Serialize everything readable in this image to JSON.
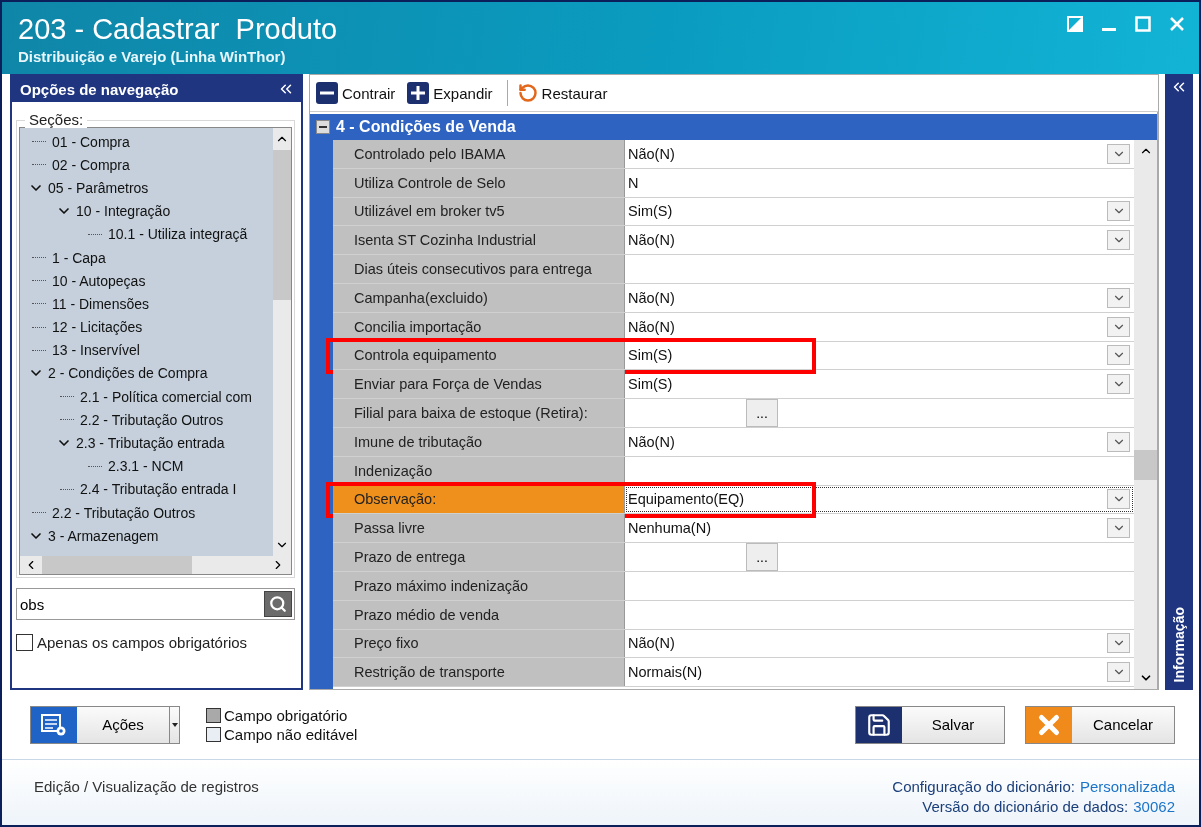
{
  "window": {
    "title": "203 - Cadastrar  Produto",
    "subtitle": "Distribuição e Varejo (Linha WinThor)"
  },
  "navigation": {
    "title": "Opções de navegação",
    "sections_label": "Seções:",
    "tree": [
      {
        "label": "01 - Compra"
      },
      {
        "label": "02 - Compra"
      },
      {
        "label": "05 - Parâmetros",
        "expanded": true,
        "children": [
          {
            "label": "10 - Integração",
            "expanded": true,
            "children": [
              {
                "label": "10.1 - Utiliza integraçã"
              }
            ]
          }
        ]
      },
      {
        "label": "1 - Capa"
      },
      {
        "label": "10 - Autopeças"
      },
      {
        "label": "11 - Dimensões"
      },
      {
        "label": "12 - Licitações"
      },
      {
        "label": "13 - Inservível"
      },
      {
        "label": "2 - Condições de Compra",
        "expanded": true,
        "children": [
          {
            "label": "2.1 - Política comercial com"
          },
          {
            "label": "2.2 - Tributação Outros"
          },
          {
            "label": "2.3 - Tributação entrada",
            "expanded": true,
            "children": [
              {
                "label": "2.3.1 - NCM"
              }
            ]
          },
          {
            "label": "2.4 - Tributação entrada I"
          }
        ]
      },
      {
        "label": "2.2 - Tributação Outros"
      },
      {
        "label": "3 - Armazenagem",
        "expanded": true
      }
    ],
    "search": {
      "value": "obs"
    },
    "required_only": {
      "label": "Apenas os campos obrigatórios",
      "checked": false
    }
  },
  "toolbar": [
    {
      "label": "Contrair",
      "kind": "collapse"
    },
    {
      "label": "Expandir",
      "kind": "expand"
    },
    {
      "label": "Restaurar",
      "kind": "restore"
    }
  ],
  "section": {
    "title": "4 - Condições de Venda",
    "expanded": true,
    "rows": [
      {
        "label": "Controlado pelo IBAMA",
        "value": "Não(N)",
        "kind": "dropdown",
        "selected": false,
        "annotated": false
      },
      {
        "label": "Utiliza Controle de Selo",
        "value": "N",
        "kind": "text",
        "selected": false,
        "annotated": false
      },
      {
        "label": "Utilizável em broker tv5",
        "value": "Sim(S)",
        "kind": "dropdown",
        "selected": false,
        "annotated": false
      },
      {
        "label": "Isenta ST Cozinha Industrial",
        "value": "Não(N)",
        "kind": "dropdown",
        "selected": false,
        "annotated": false
      },
      {
        "label": "Dias úteis consecutivos para entrega",
        "kind": "text",
        "selected": false,
        "annotated": false
      },
      {
        "label": "Campanha(excluido)",
        "value": "Não(N)",
        "kind": "dropdown",
        "selected": false,
        "annotated": false
      },
      {
        "label": "Concilia importação",
        "value": "Não(N)",
        "kind": "dropdown",
        "selected": false,
        "annotated": false
      },
      {
        "label": "Controla equipamento",
        "value": "Sim(S)",
        "kind": "dropdown",
        "selected": false,
        "annotated": true
      },
      {
        "label": "Enviar para Força de Vendas",
        "value": "Sim(S)",
        "kind": "dropdown",
        "selected": false,
        "annotated": false
      },
      {
        "label": "Filial para baixa de estoque (Retira):",
        "kind": "lookup",
        "button": "...",
        "selected": false,
        "annotated": false
      },
      {
        "label": "Imune de tributação",
        "value": "Não(N)",
        "kind": "dropdown",
        "selected": false,
        "annotated": false
      },
      {
        "label": "Indenização",
        "kind": "text",
        "selected": false,
        "annotated": false
      },
      {
        "label": "Observação:",
        "value": "Equipamento(EQ)",
        "kind": "dropdown",
        "selected": true,
        "annotated": true
      },
      {
        "label": "Passa livre",
        "value": "Nenhuma(N)",
        "kind": "dropdown",
        "selected": false,
        "annotated": false
      },
      {
        "label": "Prazo de entrega",
        "kind": "lookup",
        "button": "...",
        "selected": false,
        "annotated": false
      },
      {
        "label": "Prazo máximo indenização",
        "kind": "text",
        "selected": false,
        "annotated": false
      },
      {
        "label": "Prazo médio de venda",
        "kind": "text",
        "selected": false,
        "annotated": false
      },
      {
        "label": "Preço fixo",
        "value": "Não(N)",
        "kind": "dropdown",
        "selected": false,
        "annotated": false
      },
      {
        "label": "Restrição de transporte",
        "value": "Normais(N)",
        "kind": "dropdown",
        "selected": false,
        "annotated": false
      }
    ]
  },
  "info_panel": {
    "label": "Informação"
  },
  "actions": {
    "label": "Ações"
  },
  "legend": [
    {
      "label": "Campo obrigatório",
      "color": "#a9a9a9"
    },
    {
      "label": "Campo não editável",
      "color": "#e8eef4"
    }
  ],
  "buttons": [
    {
      "label": "Salvar",
      "kind": "save"
    },
    {
      "label": "Cancelar",
      "kind": "cancel"
    }
  ],
  "status_bar": {
    "text": "Edição / Visualização de registros",
    "details": [
      {
        "label": "Configuração do dicionário:",
        "value": "Personalizada"
      },
      {
        "label": "Versão do dicionário de dados:",
        "value": "30062"
      }
    ]
  }
}
